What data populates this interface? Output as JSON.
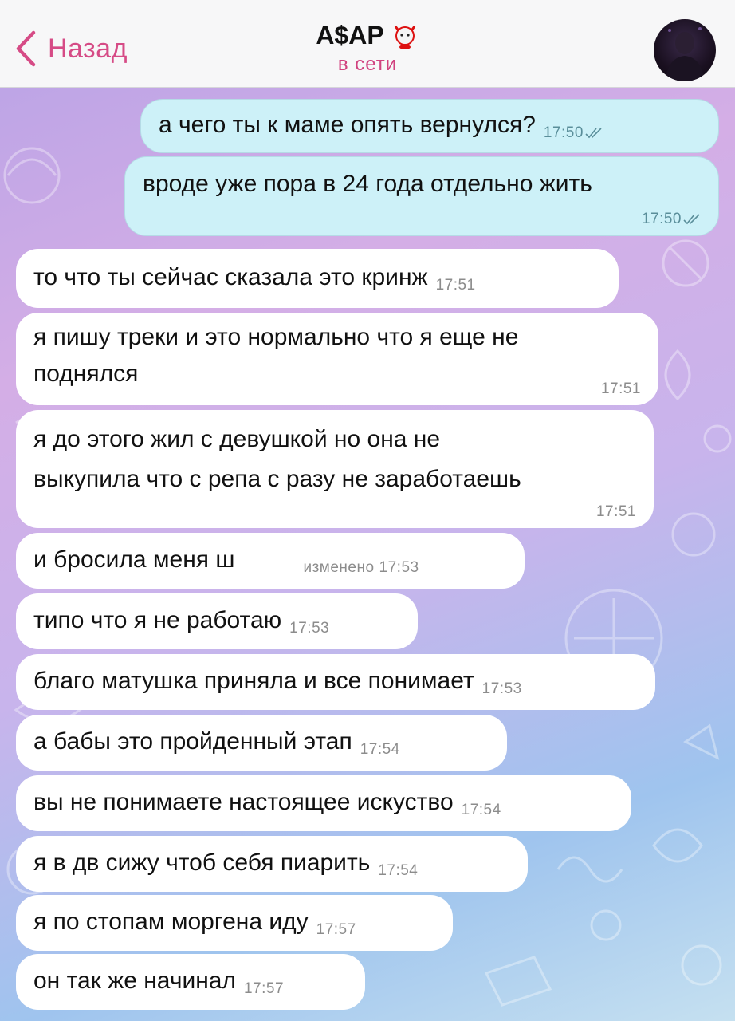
{
  "header": {
    "back_label": "Назад",
    "title": "A$AP",
    "status": "в сети"
  },
  "colors": {
    "accent": "#d64b86",
    "outgoing_bubble": "#cdf1f8",
    "incoming_bubble": "#ffffff"
  },
  "messages": [
    {
      "dir": "out",
      "text": "а чего ты к маме опять вернулся?",
      "time": "17:50",
      "read": true
    },
    {
      "dir": "out",
      "text": "вроде уже пора в 24 года отдельно жить",
      "time": "17:50",
      "read": true
    },
    {
      "dir": "in",
      "text": "то что ты сейчас сказала это кринж",
      "time": "17:51"
    },
    {
      "dir": "in",
      "line1": "я пишу треки и это нормально что я еще не",
      "line2": "поднялся",
      "time": "17:51"
    },
    {
      "dir": "in",
      "line1": "я до этого жил с девушкой но она не",
      "line2": "выкупила что с репа с разу не заработаешь",
      "time": "17:51"
    },
    {
      "dir": "in",
      "text": "и бросила меня ш",
      "edited": "изменено",
      "time": "17:53"
    },
    {
      "dir": "in",
      "text": "типо что я не работаю",
      "time": "17:53"
    },
    {
      "dir": "in",
      "text": "благо матушка приняла и все понимает",
      "time": "17:53"
    },
    {
      "dir": "in",
      "text": "а бабы это пройденный этап",
      "time": "17:54"
    },
    {
      "dir": "in",
      "text": "вы не понимаете настоящее искуство",
      "time": "17:54"
    },
    {
      "dir": "in",
      "text": "я в дв сижу чтоб себя пиарить",
      "time": "17:54"
    },
    {
      "dir": "in",
      "text": "я по стопам моргена иду",
      "time": "17:57"
    },
    {
      "dir": "in",
      "text": "он так же начинал",
      "time": "17:57"
    }
  ]
}
